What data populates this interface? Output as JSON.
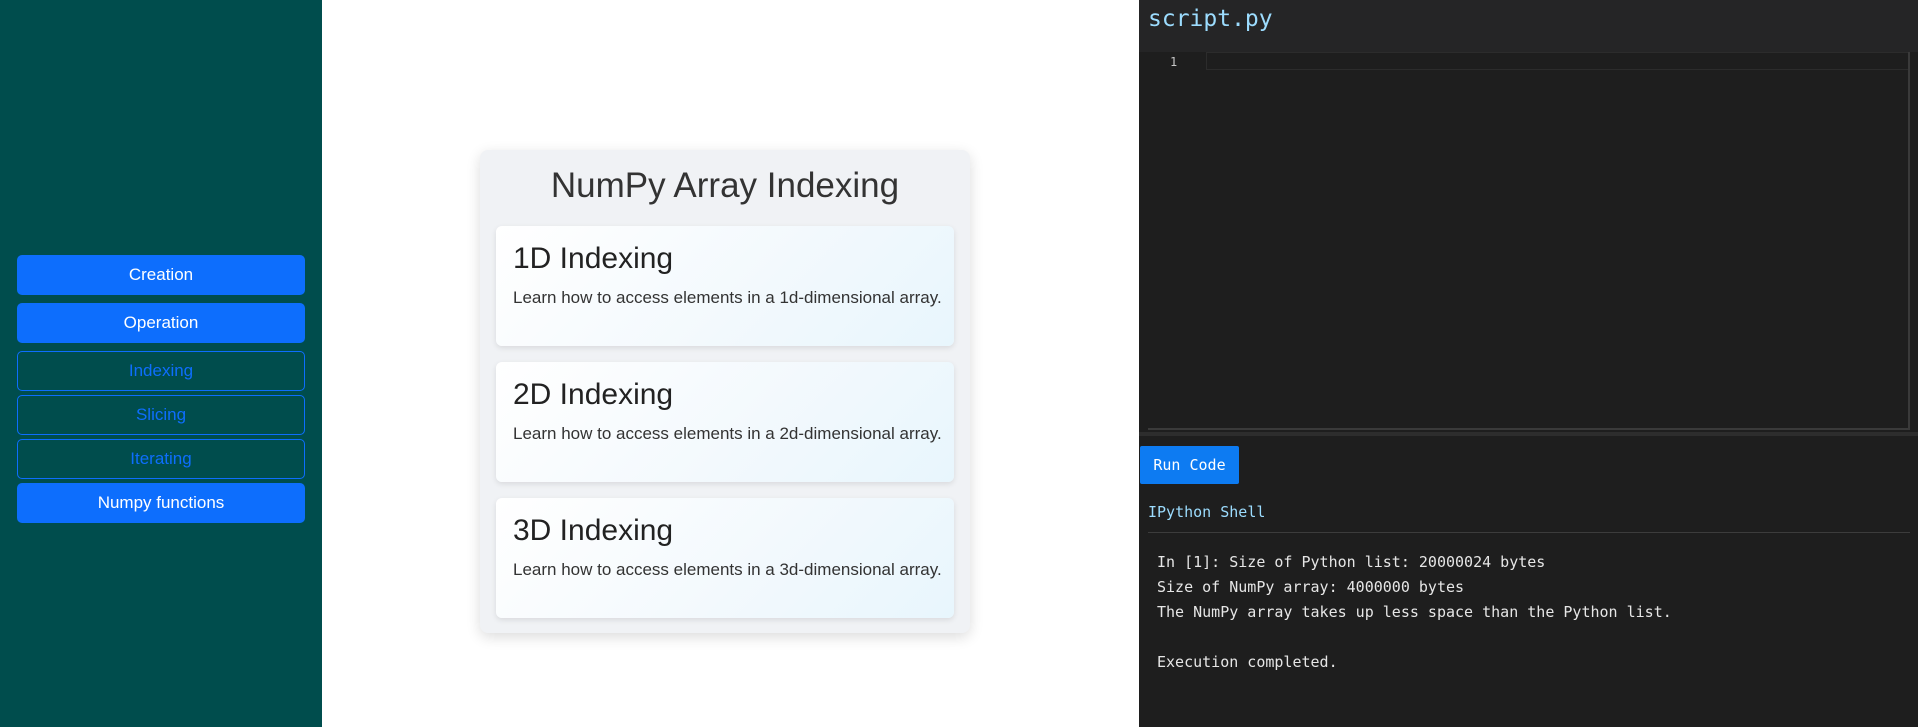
{
  "sidebar": {
    "buttons": [
      {
        "label": "Creation",
        "style": "filled"
      },
      {
        "label": "Operation",
        "style": "filled"
      },
      {
        "label": "Indexing",
        "style": "outline"
      },
      {
        "label": "Slicing",
        "style": "outline"
      },
      {
        "label": "Iterating",
        "style": "outline"
      },
      {
        "label": "Numpy functions",
        "style": "filled"
      }
    ]
  },
  "main": {
    "title": "NumPy Array Indexing",
    "cards": [
      {
        "title": "1D Indexing",
        "description": "Learn how to access elements in a 1d-dimensional array."
      },
      {
        "title": "2D Indexing",
        "description": "Learn how to access elements in a 2d-dimensional array."
      },
      {
        "title": "3D Indexing",
        "description": "Learn how to access elements in a 3d-dimensional array."
      }
    ]
  },
  "editor": {
    "file_name": "script.py",
    "line_number": "1",
    "run_label": "Run Code"
  },
  "shell": {
    "title": "IPython Shell",
    "lines": [
      "In [1]: Size of Python list: 20000024 bytes",
      "Size of NumPy array: 4000000 bytes",
      "The NumPy array takes up less space than the Python list.",
      "",
      "Execution completed."
    ]
  },
  "colors": {
    "sidebar_bg": "#004d4d",
    "accent": "#0d6efd",
    "editor_bg": "#1e1e1e",
    "editor_header_bg": "#252526",
    "file_name_color": "#9cdcfe"
  }
}
